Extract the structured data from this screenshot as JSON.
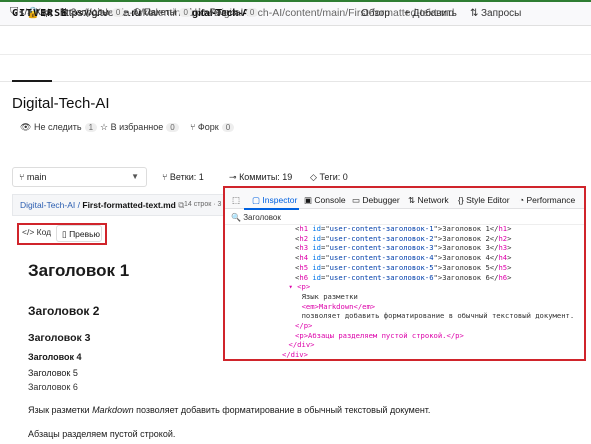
{
  "browser": {
    "url_host": "https://gitverse.ru",
    "url_path": "/Valentin-Arkov/Digital-Tech-AI/content/main/First-formatted-text.md"
  },
  "header": {
    "logo": "GITVERSE",
    "crumb_user": "Valentin-Arkov",
    "crumb_repo": "Digital-Tech-AI",
    "overview": "Обзор",
    "add": "+ Добавить",
    "requests": "Запросы"
  },
  "repo_tabs": [
    {
      "label": "Код",
      "count": ""
    },
    {
      "label": "Запросы",
      "count": "0"
    },
    {
      "label": "Пакеты",
      "count": "0"
    },
    {
      "label": "Релизы",
      "count": "0"
    }
  ],
  "repo": {
    "title": "Digital-Tech-AI",
    "actions": [
      {
        "label": "Не следить",
        "count": "1"
      },
      {
        "label": "В избранное",
        "count": "0"
      },
      {
        "label": "Форк",
        "count": "0"
      }
    ]
  },
  "branch": {
    "name": "main",
    "branches": "Ветки: 1",
    "commits": "Коммиты: 19",
    "tags": "Теги: 0"
  },
  "file": {
    "repo": "Digital-Tech-AI",
    "name": "First-formatted-text.md",
    "meta": "14 строк · 3",
    "btn_code": "Код",
    "btn_preview": "Превью"
  },
  "preview": {
    "h1": "Заголовок 1",
    "h2": "Заголовок 2",
    "h3": "Заголовок 3",
    "h4": "Заголовок 4",
    "h5": "Заголовок 5",
    "h6": "Заголовок 6",
    "para1_before": "Язык разметки ",
    "para1_em": "Markdown",
    "para1_after": " позволяет добавить форматирование в обычный текстовый документ.",
    "para2": "Абзацы разделяем пустой строкой."
  },
  "devtools": {
    "tabs": [
      "Inspector",
      "Console",
      "Debugger",
      "Network",
      "Style Editor",
      "Performance"
    ],
    "search_placeholder": "Заголовок",
    "lines": [
      {
        "indent": 6,
        "kind": "heading",
        "tag": "h1",
        "id": "user-content-заголовок-1",
        "text": "Заголовок 1"
      },
      {
        "indent": 6,
        "kind": "heading",
        "tag": "h2",
        "id": "user-content-заголовок-2",
        "text": "Заголовок 2"
      },
      {
        "indent": 6,
        "kind": "heading",
        "tag": "h3",
        "id": "user-content-заголовок-3",
        "text": "Заголовок 3"
      },
      {
        "indent": 6,
        "kind": "heading",
        "tag": "h4",
        "id": "user-content-заголовок-4",
        "text": "Заголовок 4"
      },
      {
        "indent": 6,
        "kind": "heading",
        "tag": "h5",
        "id": "user-content-заголовок-5",
        "text": "Заголовок 5"
      },
      {
        "indent": 6,
        "kind": "heading",
        "tag": "h6",
        "id": "user-content-заголовок-6",
        "text": "Заголовок 6"
      },
      {
        "indent": 5,
        "kind": "open",
        "text": "▾ <p>"
      },
      {
        "indent": 7,
        "kind": "text",
        "text": "Язык разметки"
      },
      {
        "indent": 7,
        "kind": "raw",
        "text": "<em>Markdown</em>"
      },
      {
        "indent": 7,
        "kind": "text",
        "text": "позволяет добавить форматирование в обычный текстовый документ."
      },
      {
        "indent": 6,
        "kind": "raw",
        "text": "</p>"
      },
      {
        "indent": 6,
        "kind": "raw",
        "text": "<p>Абзацы разделяем пустой строкой.</p>"
      },
      {
        "indent": 5,
        "kind": "raw",
        "text": "</div>"
      },
      {
        "indent": 4,
        "kind": "raw",
        "text": "</div>"
      }
    ]
  }
}
